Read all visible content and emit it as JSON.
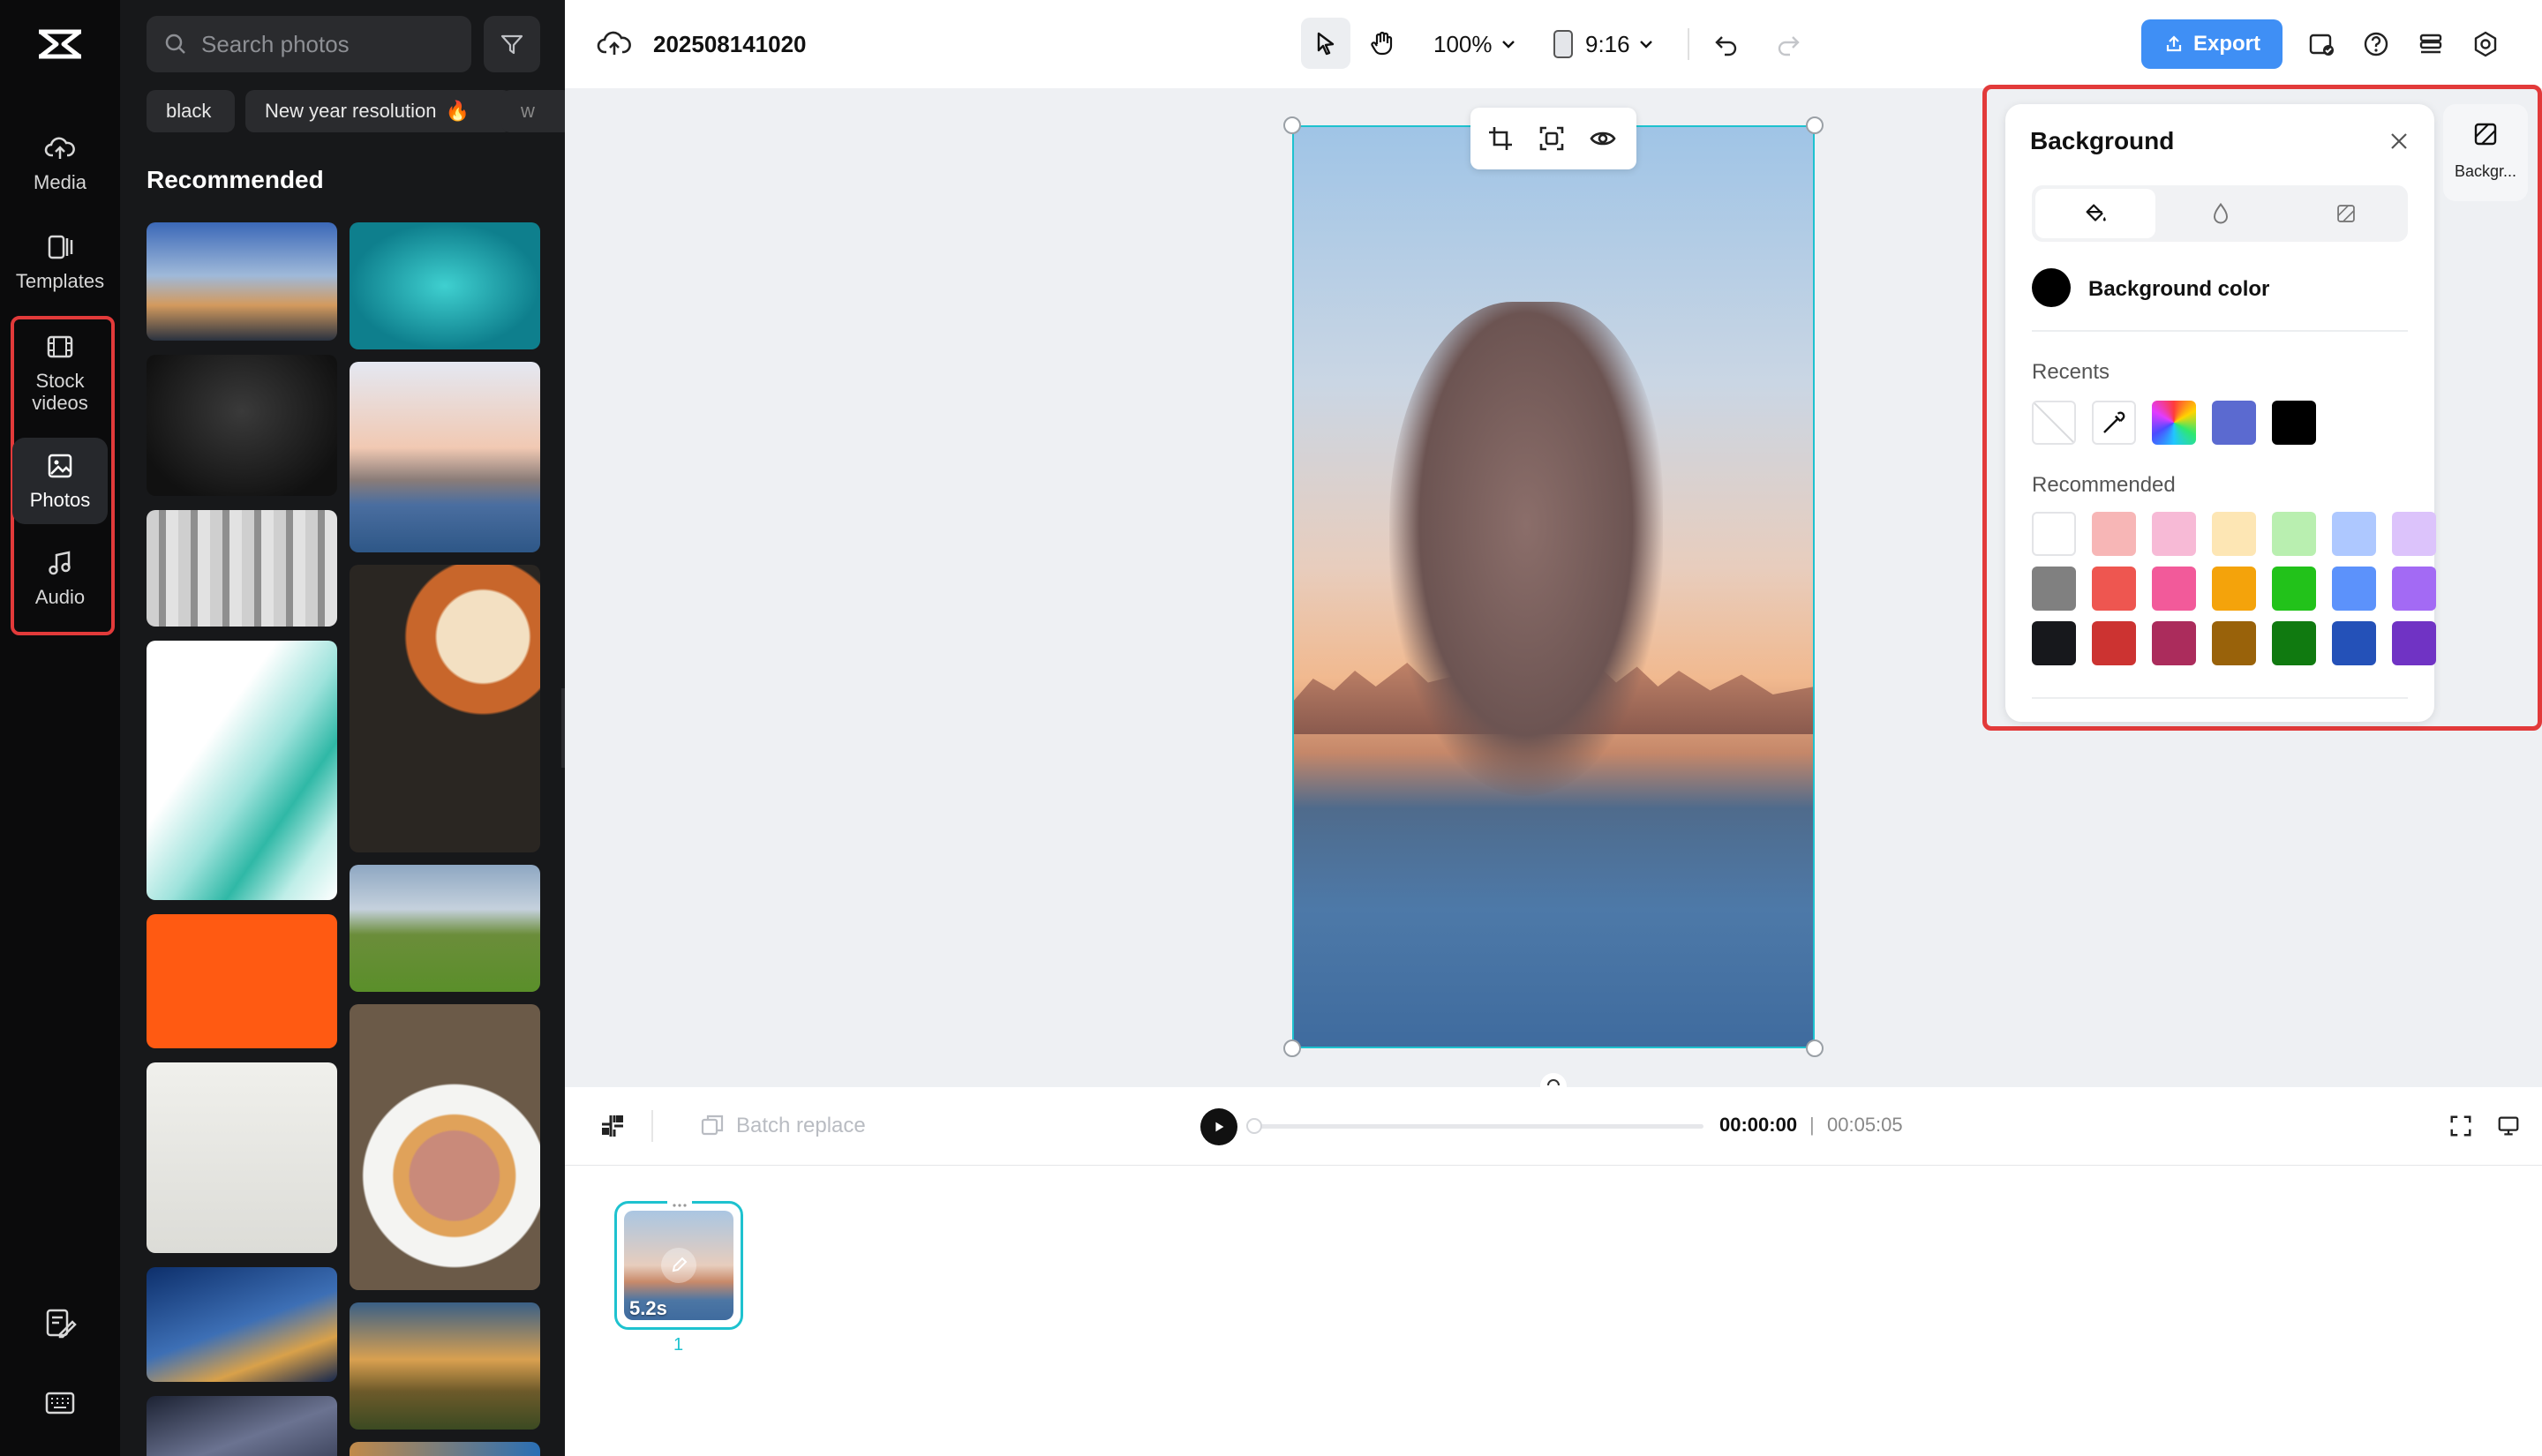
{
  "app": {
    "project_name": "202508141020"
  },
  "rail": {
    "items": [
      {
        "label": "Media"
      },
      {
        "label": "Templates"
      },
      {
        "label": "Stock videos"
      },
      {
        "label": "Photos"
      },
      {
        "label": "Audio"
      }
    ]
  },
  "photos_panel": {
    "search_placeholder": "Search photos",
    "chips": [
      "black",
      "New year resolution",
      "w"
    ],
    "section_title": "Recommended"
  },
  "toolbar": {
    "zoom": "100%",
    "ratio": "9:16",
    "export_label": "Export"
  },
  "playback": {
    "batch_replace_label": "Batch replace",
    "current_time": "00:00:00",
    "separator": "|",
    "total_time": "00:05:05"
  },
  "timeline": {
    "clip_duration": "5.2s",
    "clip_index": "1"
  },
  "background_panel": {
    "title": "Background",
    "option_label": "Background color",
    "recents_label": "Recents",
    "recommended_label": "Recommended",
    "side_tab_label": "Backgr...",
    "recent_colors": [
      "none",
      "picker",
      "gradient",
      "#5b6ad0",
      "#000000"
    ],
    "recommended_colors": [
      [
        "#ffffff",
        "#f7b6b6",
        "#f7bad6",
        "#fde6b4",
        "#b9efb0",
        "#aec8ff",
        "#dcc3fb"
      ],
      [
        "#808080",
        "#ee5650",
        "#f25a9a",
        "#f4a30b",
        "#22c21a",
        "#5c92fb",
        "#a36af4"
      ],
      [
        "#17181c",
        "#cc3331",
        "#ab2c5c",
        "#99620a",
        "#107a10",
        "#2451b8",
        "#7033c4"
      ]
    ]
  },
  "colors": {
    "accent": "#3f8ff5",
    "selection": "#1ec2cf",
    "highlight": "#e23a3a"
  }
}
